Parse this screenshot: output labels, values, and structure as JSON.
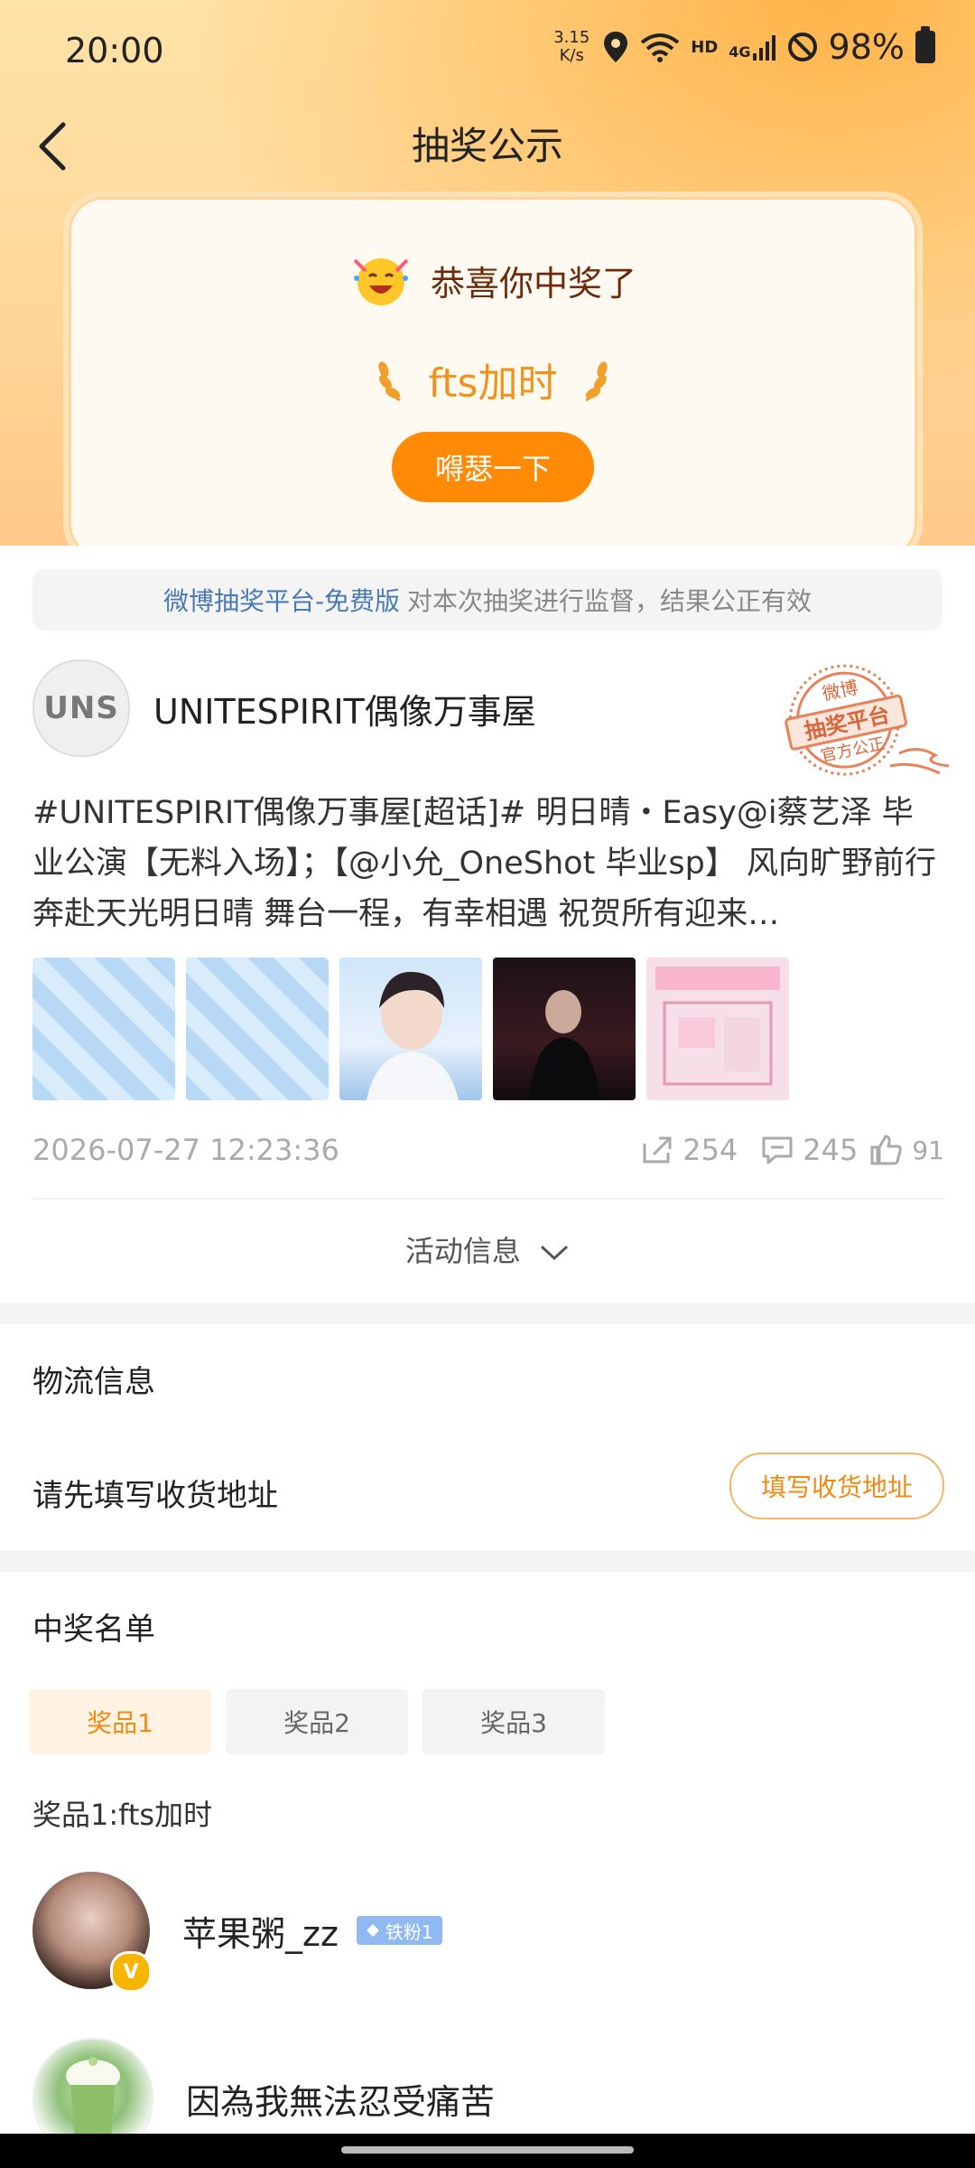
{
  "status_bar": {
    "time": "20:00",
    "speed_value": "3.15",
    "speed_unit": "K/s",
    "hd": "HD",
    "network": "4G",
    "battery": "98%"
  },
  "nav": {
    "title": "抽奖公示"
  },
  "win_card": {
    "congrats": "恭喜你中奖了",
    "prize_name": "fts加时",
    "cta_label": "嘚瑟一下"
  },
  "notice": {
    "link_text": "微博抽奖平台-免费版",
    "text": "对本次抽奖进行监督，结果公正有效"
  },
  "post": {
    "author_avatar_text": "UNS",
    "author": "UNITESPIRIT偶像万事屋",
    "text": "#UNITESPIRIT偶像万事屋[超话]# 明日晴・Easy@i蔡艺泽 毕业公演【无料入场】；【@小允_OneShot 毕业sp】 风向旷野前行 奔赴天光明日晴 舞台一程，有幸相遇 祝贺所有迎来…",
    "timestamp": "2026-07-27 12:23:36",
    "reposts": "254",
    "comments": "245",
    "likes": "91",
    "activity_label": "活动信息",
    "stamp": {
      "top": "微博",
      "middle": "抽奖平台",
      "bottom": "官方公正"
    }
  },
  "logistics": {
    "title": "物流信息",
    "address_prompt": "请先填写收货地址",
    "address_button": "填写收货地址"
  },
  "winners": {
    "title": "中奖名单",
    "tabs": [
      "奖品1",
      "奖品2",
      "奖品3"
    ],
    "prize_label": "奖品1:fts加时",
    "list": [
      {
        "name": "苹果粥_zz",
        "badge": "铁粉1"
      },
      {
        "name": "因為我無法忍受痛苦"
      }
    ]
  },
  "colors": {
    "accent": "#ff8a05",
    "link": "#4a7ab2",
    "prize_text": "#f0931a"
  }
}
